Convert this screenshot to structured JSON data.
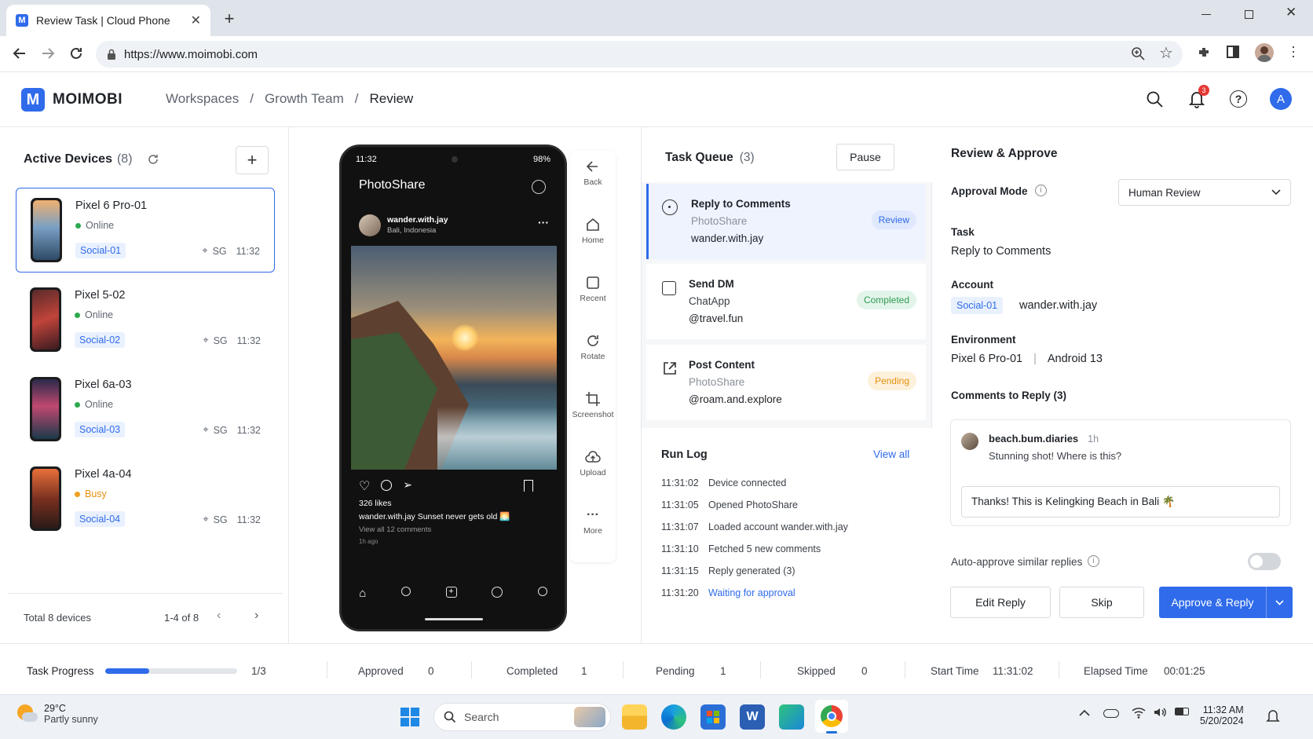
{
  "browser": {
    "tab_title": "Review Task | Cloud Phone",
    "favicon_letter": "M",
    "url": "https://www.moimobi.com"
  },
  "app": {
    "logo_letter": "M",
    "brand": "MOIMOBI",
    "breadcrumb": [
      "Workspaces",
      "Growth Team",
      "Review"
    ],
    "notification_count": "3",
    "avatar_letter": "A",
    "accent": "#2f6bea"
  },
  "devices_panel": {
    "title": "Active Devices",
    "count": "(8)",
    "devices": [
      {
        "name": "Pixel 6 Pro-01",
        "status": "Online",
        "tag": "Social-01",
        "region": "SG",
        "time": "11:32",
        "status_color": "#2ea84f"
      },
      {
        "name": "Pixel 5-02",
        "status": "Online",
        "tag": "Social-02",
        "region": "SG",
        "time": "11:32",
        "status_color": "#2ea84f"
      },
      {
        "name": "Pixel 6a-03",
        "status": "Online",
        "tag": "Social-03",
        "region": "SG",
        "time": "11:32",
        "status_color": "#2ea84f"
      },
      {
        "name": "Pixel 4a-04",
        "status": "Busy",
        "tag": "Social-04",
        "region": "SG",
        "time": "11:32",
        "status_color": "#f0a020"
      }
    ],
    "total": "Total 8 devices",
    "pagination": "1-4 of 8"
  },
  "phone": {
    "clock": "11:32",
    "battery": "98%",
    "app_name": "PhotoShare",
    "post_user": "wander.with.jay",
    "post_location": "Bali, Indonesia",
    "likes": "326 likes",
    "caption_user": "wander.with.jay",
    "caption_text": "Sunset never gets old 🌅",
    "view_comments": "View all 12 comments",
    "posted_ago": "1h ago"
  },
  "side_controls": [
    {
      "label": "Back",
      "icon": "arrow-left-icon"
    },
    {
      "label": "Home",
      "icon": "home-icon"
    },
    {
      "label": "Recent",
      "icon": "square-icon"
    },
    {
      "label": "Rotate",
      "icon": "rotate-icon"
    },
    {
      "label": "Screenshot",
      "icon": "crop-icon"
    },
    {
      "label": "Upload",
      "icon": "cloud-upload-icon"
    },
    {
      "label": "More",
      "icon": "more-icon"
    }
  ],
  "queue": {
    "title": "Task Queue",
    "count": "(3)",
    "pause_label": "Pause",
    "items": [
      {
        "title": "Reply to Comments",
        "app": "PhotoShare",
        "account": "wander.with.jay",
        "badge": "Review"
      },
      {
        "title": "Send DM",
        "app": "ChatApp",
        "account": "@travel.fun",
        "badge": "Completed"
      },
      {
        "title": "Post Content",
        "app": "PhotoShare",
        "account": "@roam.and.explore",
        "badge": "Pending"
      }
    ]
  },
  "run_log": {
    "title": "Run Log",
    "view_all": "View all",
    "entries": [
      {
        "time": "11:31:02",
        "text": "Device connected"
      },
      {
        "time": "11:31:05",
        "text": "Opened PhotoShare"
      },
      {
        "time": "11:31:07",
        "text": "Loaded account wander.with.jay"
      },
      {
        "time": "11:31:10",
        "text": "Fetched 5 new comments"
      },
      {
        "time": "11:31:15",
        "text": "Reply generated (3)"
      },
      {
        "time": "11:31:20",
        "text": "Waiting for approval"
      }
    ]
  },
  "review": {
    "title": "Review & Approve",
    "approval_mode_label": "Approval Mode",
    "approval_mode_value": "Human Review",
    "task_label": "Task",
    "task_value": "Reply to Comments",
    "account_label": "Account",
    "account_tag": "Social-01",
    "account_value": "wander.with.jay",
    "environment_label": "Environment",
    "environment_device": "Pixel 6 Pro-01",
    "environment_os": "Android 13",
    "comments_label": "Comments to Reply (3)",
    "comment_user": "beach.bum.diaries",
    "comment_time": "1h",
    "comment_text": "Stunning shot! Where is this?",
    "reply_text": "Thanks! This is Kelingking Beach in Bali 🌴",
    "auto_approve_label": "Auto-approve similar replies",
    "auto_approve_on": false,
    "edit_label": "Edit Reply",
    "skip_label": "Skip",
    "approve_label": "Approve & Reply"
  },
  "footer": {
    "progress_label": "Task Progress",
    "progress_fraction": 0.333,
    "progress_text": "1/3",
    "stats": [
      {
        "label": "Approved",
        "value": "0"
      },
      {
        "label": "Completed",
        "value": "1"
      },
      {
        "label": "Pending",
        "value": "1"
      },
      {
        "label": "Skipped",
        "value": "0"
      }
    ],
    "start_label": "Start Time",
    "start_value": "11:31:02",
    "elapsed_label": "Elapsed Time",
    "elapsed_value": "00:01:25"
  },
  "taskbar": {
    "temperature": "29°C",
    "weather": "Partly sunny",
    "search_placeholder": "Search",
    "time": "11:32 AM",
    "date": "5/20/2024"
  }
}
